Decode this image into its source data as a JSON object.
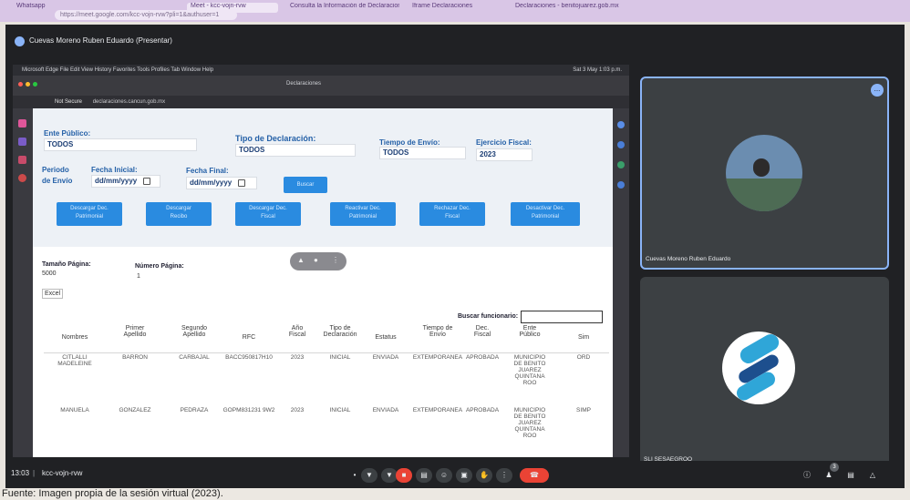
{
  "browser": {
    "tabs": [
      "Whatsapp",
      "Meet - kcc-vojn-rvw",
      "Consulta la Información de Declaraciones",
      "Iframe Declaraciones",
      "Declaraciones - benitojuarez.gob.mx"
    ],
    "address": "https://meet.google.com/kcc-vojn-rvw?pli=1&authuser=1"
  },
  "meet": {
    "presenter_title": "Cuevas Moreno Ruben Eduardo (Presentar)",
    "participants": [
      {
        "name": "Cuevas Moreno Ruben Eduardo"
      },
      {
        "name": "SLI SESAEGROO"
      }
    ],
    "time": "13:03",
    "meeting_code": "kcc-vojn-rvw",
    "more_badge": "...",
    "people_count": "3"
  },
  "shared": {
    "menubar": "Microsoft Edge   File   Edit   View   History   Favorites   Tools   Profiles   Tab   Window   Help",
    "mac_time": "Sat 3 May  1:03 p.m.",
    "window_title": "Declaraciones",
    "not_secure": "Not Secure",
    "url": "declaraciones.cancun.gob.mx"
  },
  "form": {
    "ente_label": "Ente Público:",
    "ente_value": "TODOS",
    "tipo_label": "Tipo de Declaración:",
    "tipo_value": "TODOS",
    "tiempo_label": "Tiempo de Envío:",
    "tiempo_value": "TODOS",
    "ejercicio_label": "Ejercicio Fiscal:",
    "ejercicio_value": "2023",
    "periodo_label_1": "Periodo",
    "periodo_label_2": "de Envío",
    "fecha_inicial_label": "Fecha Inicial:",
    "fecha_inicial_placeholder": "dd/mm/yyyy",
    "fecha_final_label": "Fecha Final:",
    "fecha_final_placeholder": "dd/mm/yyyy",
    "buscar": "Buscar",
    "actions": [
      [
        "Descargar Dec.",
        "Patrimonial"
      ],
      [
        "Descargar",
        "Recibo"
      ],
      [
        "Descargar Dec.",
        "Fiscal"
      ],
      [
        "Reactivar Dec.",
        "Patrimonial"
      ],
      [
        "Rechazar Dec.",
        "Fiscal"
      ],
      [
        "Desactivar Dec.",
        "Patrimonial"
      ]
    ],
    "tamano_label": "Tamaño Página:",
    "tamano_value": "5000",
    "numero_label": "Número Página:",
    "numero_value": "1",
    "excel": "Excel",
    "buscar_funcionario": "Buscar funcionario:"
  },
  "table": {
    "headers": [
      [
        "Nombres"
      ],
      [
        "Primer",
        "Apellido"
      ],
      [
        "Segundo",
        "Apellido"
      ],
      [
        "RFC"
      ],
      [
        "Año",
        "Fiscal"
      ],
      [
        "Tipo de",
        "Declaración"
      ],
      [
        "Estatus"
      ],
      [
        "Tiempo de",
        "Envío"
      ],
      [
        "Dec.",
        "Fiscal"
      ],
      [
        "Ente",
        "Público"
      ],
      [
        "Sim"
      ]
    ],
    "rows": [
      [
        [
          "CITLALLI",
          "MADELEINE"
        ],
        [
          "BARRON"
        ],
        [
          "CARBAJAL"
        ],
        [
          "BACC950817H10"
        ],
        [
          "2023"
        ],
        [
          "INICIAL"
        ],
        [
          "ENVIADA"
        ],
        [
          "EXTEMPORANEA"
        ],
        [
          "APROBADA"
        ],
        [
          "MUNICIPIO",
          "DE BENITO",
          "JUAREZ",
          "QUINTANA",
          "ROO"
        ],
        [
          "ORD"
        ]
      ],
      [
        [
          "MANUELA"
        ],
        [
          "GONZALEZ"
        ],
        [
          "PEDRAZA"
        ],
        [
          "GOPM831231 9W2"
        ],
        [
          "2023"
        ],
        [
          "INICIAL"
        ],
        [
          "ENVIADA"
        ],
        [
          "EXTEMPORANEA"
        ],
        [
          "APROBADA"
        ],
        [
          "MUNICIPIO",
          "DE BENITO",
          "JUAREZ",
          "QUINTANA",
          "ROO"
        ],
        [
          "SIMP"
        ]
      ]
    ]
  },
  "caption": "Fuente: Imagen propia de la sesión virtual (2023)."
}
